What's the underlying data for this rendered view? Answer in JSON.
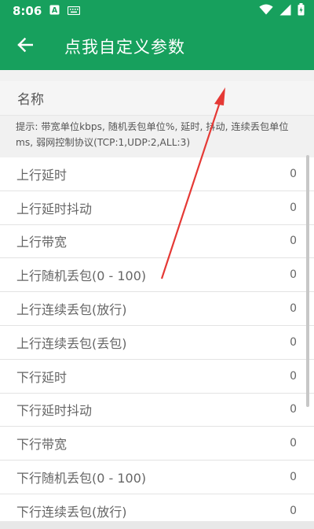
{
  "status_bar": {
    "time": "8:06",
    "notification_icons": [
      "a-box-icon",
      "keyboard-icon"
    ],
    "right_icons": [
      "wifi-icon",
      "signal-icon",
      "battery-icon"
    ]
  },
  "app_bar": {
    "title": "点我自定义参数"
  },
  "form": {
    "name_placeholder": "名称",
    "hint": "提示: 带宽单位kbps, 随机丢包单位%, 延时, 抖动, 连续丢包单位ms, 弱网控制协议(TCP:1,UDP:2,ALL:3)"
  },
  "params": [
    {
      "label": "上行延时",
      "value": "0"
    },
    {
      "label": "上行延时抖动",
      "value": "0"
    },
    {
      "label": "上行带宽",
      "value": "0"
    },
    {
      "label": "上行随机丢包(0 - 100)",
      "value": "0"
    },
    {
      "label": "上行连续丢包(放行)",
      "value": "0"
    },
    {
      "label": "上行连续丢包(丢包)",
      "value": "0"
    },
    {
      "label": "下行延时",
      "value": "0"
    },
    {
      "label": "下行延时抖动",
      "value": "0"
    },
    {
      "label": "下行带宽",
      "value": "0"
    },
    {
      "label": "下行随机丢包(0 - 100)",
      "value": "0"
    },
    {
      "label": "下行连续丢包(放行)",
      "value": "0"
    }
  ],
  "colors": {
    "primary": "#17a05d",
    "annotation_arrow": "#e53935"
  }
}
